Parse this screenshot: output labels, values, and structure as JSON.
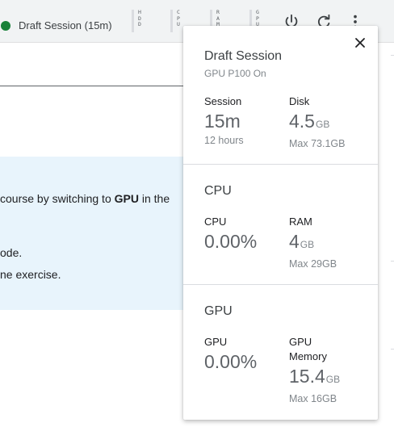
{
  "toolbar": {
    "session_label": "Draft Session (15m)",
    "status_color": "#188038",
    "meters": [
      {
        "label": "H\nD\nD"
      },
      {
        "label": "C\nP\nU"
      },
      {
        "label": "R\nA\nM"
      },
      {
        "label": "G\nP\nU"
      }
    ],
    "icons": [
      "power-icon",
      "refresh-icon",
      "more-vert-icon"
    ]
  },
  "page": {
    "callout_line1_pre": "course by switching to ",
    "callout_line1_bold": "GPU",
    "callout_line1_post": " in the",
    "callout_line2": "ode.",
    "callout_line3": "ne exercise."
  },
  "popover": {
    "title": "Draft Session",
    "subtitle": "GPU P100 On",
    "close_icon": "close-icon",
    "session": {
      "session_label": "Session",
      "session_value": "15m",
      "session_caption": "12 hours",
      "disk_label": "Disk",
      "disk_value": "4.5",
      "disk_unit": "GB",
      "disk_caption": "Max 73.1GB"
    },
    "cpu": {
      "title": "CPU",
      "cpu_label": "CPU",
      "cpu_value": "0.00%",
      "ram_label": "RAM",
      "ram_value": "4",
      "ram_unit": "GB",
      "ram_caption": "Max 29GB"
    },
    "gpu": {
      "title": "GPU",
      "gpu_label": "GPU",
      "gpu_value": "0.00%",
      "mem_label": "GPU\nMemory",
      "mem_value": "15.4",
      "mem_unit": "GB",
      "mem_caption": "Max 16GB"
    }
  }
}
